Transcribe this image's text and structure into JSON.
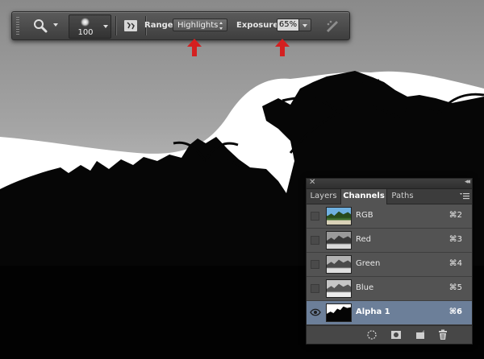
{
  "options_bar": {
    "tool_icon": "zoom-magnifier-icon",
    "brush_size": "100",
    "brush_panel_icon": "brush-panel-icon",
    "range_label": "Range:",
    "range_value": "Highlights",
    "exposure_label": "Exposure:",
    "exposure_value": "65%",
    "airbrush_icon": "airbrush-icon"
  },
  "annotations": {
    "arrow_color": "#d42020"
  },
  "channels_panel": {
    "tabs": [
      {
        "label": "Layers"
      },
      {
        "label": "Channels"
      },
      {
        "label": "Paths"
      }
    ],
    "active_tab": "Channels",
    "channels": [
      {
        "name": "RGB",
        "shortcut": "⌘2",
        "visible": false,
        "selected": false
      },
      {
        "name": "Red",
        "shortcut": "⌘3",
        "visible": false,
        "selected": false
      },
      {
        "name": "Green",
        "shortcut": "⌘4",
        "visible": false,
        "selected": false
      },
      {
        "name": "Blue",
        "shortcut": "⌘5",
        "visible": false,
        "selected": false
      },
      {
        "name": "Alpha 1",
        "shortcut": "⌘6",
        "visible": true,
        "selected": true
      }
    ],
    "footer_icons": [
      "load-selection-icon",
      "save-selection-icon",
      "new-channel-icon",
      "delete-icon"
    ],
    "selected_row_color": "#6c7f99"
  }
}
